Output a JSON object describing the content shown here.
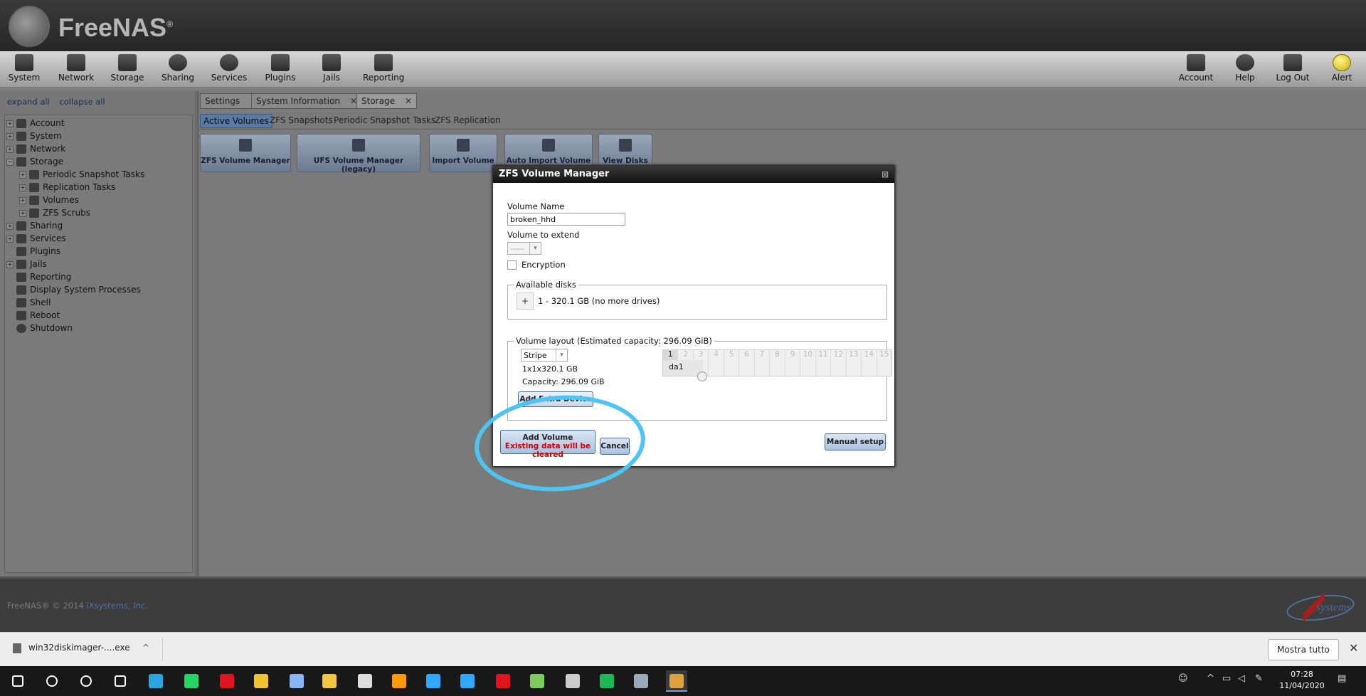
{
  "app": {
    "logo_text": "FreeNAS",
    "logo_reg": "®"
  },
  "toolbar": {
    "left": [
      "System",
      "Network",
      "Storage",
      "Sharing",
      "Services",
      "Plugins",
      "Jails",
      "Reporting"
    ],
    "right": [
      "Account",
      "Help",
      "Log Out",
      "Alert"
    ]
  },
  "sidebar": {
    "expand_all": "expand all",
    "collapse_all": "collapse all",
    "tree": [
      "Account",
      "System",
      "Network",
      "Storage",
      "Periodic Snapshot Tasks",
      "Replication Tasks",
      "Volumes",
      "ZFS Scrubs",
      "Sharing",
      "Services",
      "Plugins",
      "Jails",
      "Reporting",
      "Display System Processes",
      "Shell",
      "Reboot",
      "Shutdown"
    ]
  },
  "tabs": [
    "Settings",
    "System Information",
    "Storage"
  ],
  "tab_close": "✕",
  "subtabs": [
    "Active Volumes",
    "ZFS Snapshots",
    "Periodic Snapshot Tasks",
    "ZFS Replication"
  ],
  "actions": [
    "ZFS Volume Manager",
    "UFS Volume Manager (legacy)",
    "Import Volume",
    "Auto Import Volume",
    "View Disks"
  ],
  "dialog": {
    "title": "ZFS Volume Manager",
    "close": "⊠",
    "volume_name_label": "Volume Name",
    "volume_name_value": "broken_hhd",
    "extend_label": "Volume to extend",
    "extend_value": "-----",
    "encryption_label": "Encryption",
    "available_disks_legend": "Available disks",
    "add_disk": "+",
    "disk_text": "1 - 320.1 GB (no more drives)",
    "layout_legend": "Volume layout (Estimated capacity: 296.09 GiB)",
    "layout_type": "Stripe",
    "layout_size": "1x1x320.1 GB",
    "layout_capacity": "Capacity: 296.09 GiB",
    "grid_numbers": [
      "1",
      "2",
      "3",
      "4",
      "5",
      "6",
      "7",
      "8",
      "9",
      "10",
      "11",
      "12",
      "13",
      "14",
      "15"
    ],
    "grid_disk": "da1",
    "add_extra_device": "Add Extra Device",
    "add_volume": "Add Volume",
    "add_volume_warning": "Existing data will be cleared",
    "cancel": "Cancel",
    "manual_setup": "Manual setup"
  },
  "footer": {
    "copyright": "FreeNAS® © 2014",
    "company": "iXsystems, Inc.",
    "logo_text": "systems"
  },
  "download_bar": {
    "file": "win32diskimager-....exe",
    "chevron": "^",
    "show_all": "Mostra tutto",
    "close": "✕"
  },
  "taskbar": {
    "time": "07:28",
    "date": "11/04/2020",
    "apps": [
      {
        "name": "start-icon",
        "color": "#ffffff"
      },
      {
        "name": "search-icon",
        "color": "#ffffff"
      },
      {
        "name": "cortana-icon",
        "color": "#ffffff"
      },
      {
        "name": "task-view-icon",
        "color": "#ffffff"
      },
      {
        "name": "telegram-icon",
        "color": "#2ca5e0"
      },
      {
        "name": "whatsapp-icon",
        "color": "#25d366"
      },
      {
        "name": "opera-icon",
        "color": "#e0141e"
      },
      {
        "name": "chrome-icon",
        "color": "#f1c232"
      },
      {
        "name": "feather-icon",
        "color": "#8ab4f8"
      },
      {
        "name": "explorer-icon",
        "color": "#f4c542"
      },
      {
        "name": "clock-app-icon",
        "color": "#dddddd"
      },
      {
        "name": "illustrator-icon",
        "color": "#ff9a00"
      },
      {
        "name": "photoshop-icon",
        "color": "#31a8ff"
      },
      {
        "name": "lightroom-icon",
        "color": "#31a8ff"
      },
      {
        "name": "animate-icon",
        "color": "#e0141e"
      },
      {
        "name": "network-app-icon",
        "color": "#7acc60"
      },
      {
        "name": "steam-alt-icon",
        "color": "#cccccc"
      },
      {
        "name": "spotify-icon",
        "color": "#1db954"
      },
      {
        "name": "steam-icon",
        "color": "#9ab"
      },
      {
        "name": "app-active-icon",
        "color": "#e0a040"
      }
    ]
  },
  "colors": {
    "accent": "#4ec4f0",
    "warning": "#cc0000",
    "dialog_title": "#111111"
  }
}
